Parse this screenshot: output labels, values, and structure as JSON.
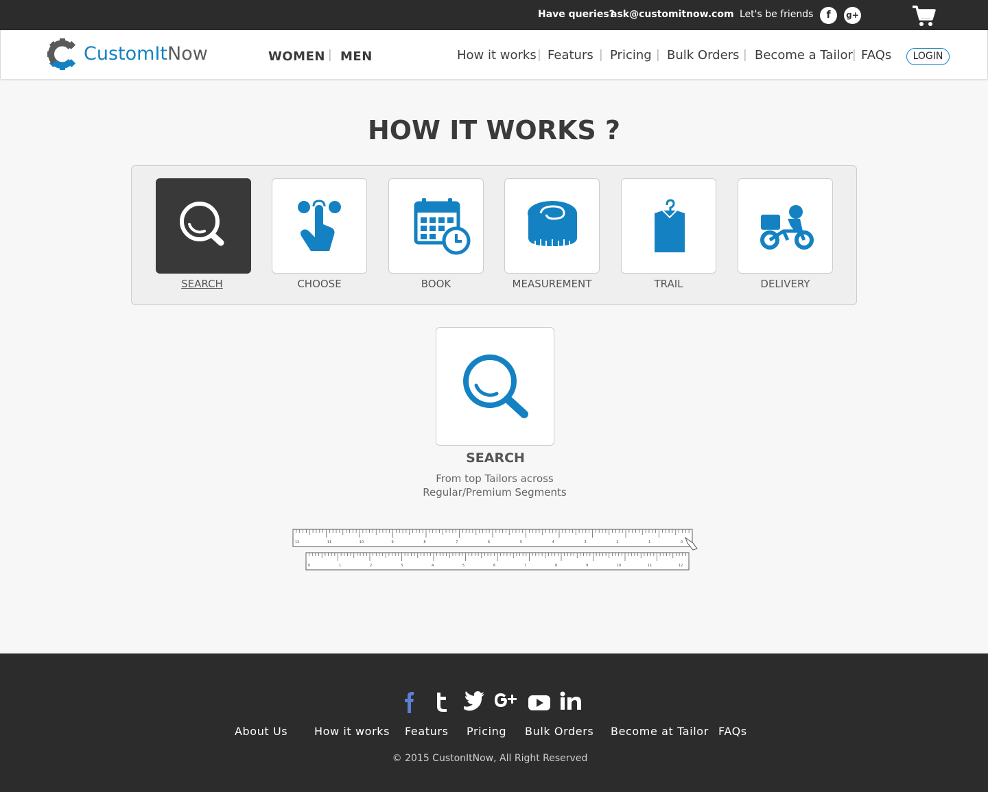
{
  "topbar": {
    "queries_label": "Have queries?",
    "email": "ask@customitnow.com",
    "friends_label": "Let's be friends",
    "facebook_glyph": "f",
    "gplus_glyph": "g+",
    "icons": [
      "facebook-icon",
      "google-plus-icon",
      "cart-icon"
    ]
  },
  "header": {
    "logo_custom": "CustomIt",
    "logo_now": "Now",
    "women": "WOMEN",
    "men": "MEN",
    "separator": "|",
    "nav": [
      "How it works",
      "Featurs",
      "Pricing",
      "Bulk Orders",
      "Become a Tailor",
      "FAQs"
    ],
    "login": "LOGIN"
  },
  "main": {
    "title": "HOW IT WORKS ?",
    "steps": [
      {
        "label": "SEARCH",
        "icon": "search-icon",
        "active": true
      },
      {
        "label": "CHOOSE",
        "icon": "tap-icon",
        "active": false
      },
      {
        "label": "BOOK",
        "icon": "calendar-icon",
        "active": false
      },
      {
        "label": "MEASUREMENT",
        "icon": "measuring-tape-icon",
        "active": false
      },
      {
        "label": "TRAIL",
        "icon": "shirt-hanger-icon",
        "active": false
      },
      {
        "label": "DELIVERY",
        "icon": "delivery-bike-icon",
        "active": false
      }
    ],
    "detail": {
      "title": "SEARCH",
      "line1": "From top Tailors across",
      "line2": "Regular/Premium Segments"
    },
    "tape_top_numbers": [
      "12",
      "11",
      "10",
      "9",
      "8",
      "7",
      "6",
      "5",
      "4",
      "3",
      "2",
      "1",
      "0"
    ],
    "tape_bottom_numbers": [
      "0",
      "1",
      "2",
      "3",
      "4",
      "5",
      "6",
      "7",
      "8",
      "9",
      "10",
      "11",
      "12"
    ]
  },
  "footer": {
    "social_icons": [
      "facebook-icon",
      "tumblr-icon",
      "twitter-icon",
      "google-plus-icon",
      "youtube-icon",
      "linkedin-icon"
    ],
    "links": [
      "About Us",
      "How it works",
      "Featurs",
      "Pricing",
      "Bulk Orders",
      "Become at Tailor",
      "FAQs"
    ],
    "copyright": "© 2015 CustonItNow, All Right Reserved"
  },
  "colors": {
    "brand_blue": "#1482c2",
    "dark": "#2c2c2c",
    "active_step": "#3a3939"
  }
}
